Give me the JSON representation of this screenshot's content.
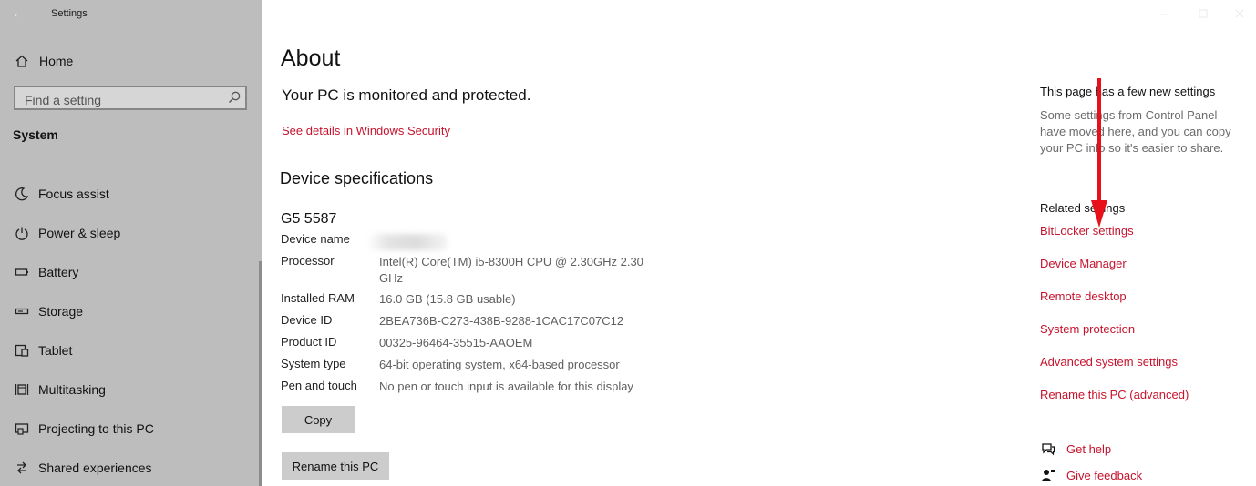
{
  "window": {
    "title": "Settings"
  },
  "sidebar": {
    "home_label": "Home",
    "search_placeholder": "Find a setting",
    "section_title": "System",
    "items": [
      {
        "label": "Focus assist",
        "icon": "moon-icon"
      },
      {
        "label": "Power & sleep",
        "icon": "power-icon"
      },
      {
        "label": "Battery",
        "icon": "battery-icon"
      },
      {
        "label": "Storage",
        "icon": "storage-icon"
      },
      {
        "label": "Tablet",
        "icon": "tablet-icon"
      },
      {
        "label": "Multitasking",
        "icon": "multitasking-icon"
      },
      {
        "label": "Projecting to this PC",
        "icon": "projecting-icon"
      },
      {
        "label": "Shared experiences",
        "icon": "shared-experiences-icon"
      }
    ]
  },
  "main": {
    "title": "About",
    "protection_message": "Your PC is monitored and protected.",
    "security_link": "See details in Windows Security",
    "device_spec_heading": "Device specifications",
    "model_name": "G5 5587",
    "specs": [
      {
        "label": "Device name",
        "value": ""
      },
      {
        "label": "Processor",
        "value": "Intel(R) Core(TM) i5-8300H CPU @ 2.30GHz   2.30 GHz"
      },
      {
        "label": "Installed RAM",
        "value": "16.0 GB (15.8 GB usable)"
      },
      {
        "label": "Device ID",
        "value": "2BEA736B-C273-438B-9288-1CAC17C07C12"
      },
      {
        "label": "Product ID",
        "value": "00325-96464-35515-AAOEM"
      },
      {
        "label": "System type",
        "value": "64-bit operating system, x64-based processor"
      },
      {
        "label": "Pen and touch",
        "value": "No pen or touch input is available for this display"
      }
    ],
    "copy_button": "Copy",
    "rename_button": "Rename this PC"
  },
  "right_panel": {
    "new_settings_heading": "This page has a few new settings",
    "new_settings_body": "Some settings from Control Panel have moved here, and you can copy your PC info so it's easier to share.",
    "related_heading": "Related settings",
    "related_links": [
      "BitLocker settings",
      "Device Manager",
      "Remote desktop",
      "System protection",
      "Advanced system settings",
      "Rename this PC (advanced)"
    ],
    "help_label": "Get help",
    "feedback_label": "Give feedback"
  },
  "colors": {
    "link_red": "#c7132d",
    "sidebar_bg": "#bdbdbd",
    "annotation_arrow": "#e8101a"
  }
}
